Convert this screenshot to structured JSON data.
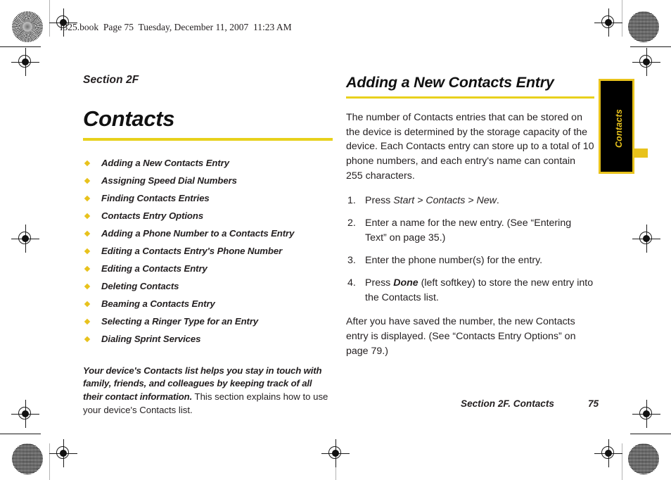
{
  "header": {
    "print_line": "I325.book  Page 75  Tuesday, December 11, 2007  11:23 AM"
  },
  "left_column": {
    "section_label": "Section 2F",
    "chapter_title": "Contacts",
    "toc_items": [
      "Adding a New Contacts Entry",
      "Assigning Speed Dial Numbers",
      "Finding Contacts Entries",
      "Contacts Entry Options",
      "Adding a Phone Number to a Contacts Entry",
      "Editing a Contacts Entry's Phone Number",
      "Editing a Contacts Entry",
      "Deleting Contacts",
      "Beaming a Contacts Entry",
      "Selecting a Ringer Type for an Entry",
      "Dialing Sprint Services"
    ],
    "intro_lead": "Your device's Contacts list helps you stay in touch with family, friends, and colleagues by keeping track of all their contact information.",
    "intro_rest": " This section explains how to use your device's Contacts list."
  },
  "right_column": {
    "heading": "Adding a New Contacts Entry",
    "intro_paragraph": "The number of Contacts entries that can be stored on the device is determined by the storage capacity of the device. Each Contacts entry can store up to a total of 10 phone numbers, and each entry's name can contain 255 characters.",
    "steps": [
      {
        "prefix": "Press ",
        "emphasis": "Start > Contacts > New",
        "emphasis_style": "italic",
        "suffix": "."
      },
      {
        "prefix": "Enter a name for the new entry. (See “Entering Text” on page 35.)",
        "emphasis": "",
        "emphasis_style": "none",
        "suffix": ""
      },
      {
        "prefix": "Enter the phone number(s) for the entry.",
        "emphasis": "",
        "emphasis_style": "none",
        "suffix": ""
      },
      {
        "prefix": "Press ",
        "emphasis": "Done",
        "emphasis_style": "bold-italic",
        "suffix": " (left softkey) to store the new entry into the Contacts list."
      }
    ],
    "closing_paragraph": "After you have saved the number, the new Contacts entry is displayed. (See “Contacts Entry Options” on page 79.)"
  },
  "side_tab": {
    "label": "Contacts"
  },
  "footer": {
    "section": "Section 2F. Contacts",
    "page_number": "75"
  },
  "colors": {
    "accent_yellow": "#e8d11c",
    "tab_yellow": "#e8c21c",
    "tab_background": "#000000",
    "text": "#231f20"
  }
}
